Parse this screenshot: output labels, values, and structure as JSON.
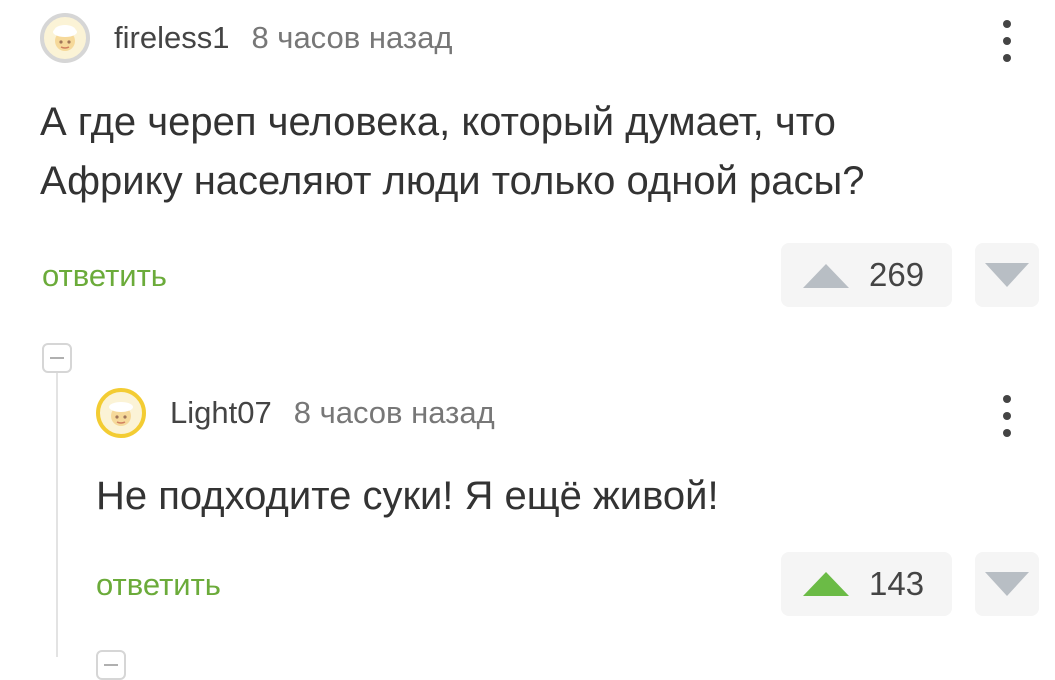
{
  "comments": [
    {
      "username": "fireless1",
      "time": "8 часов назад",
      "text_lines": [
        "А где череп человека, который думает, что",
        "Африку населяют люди только одной расы?"
      ],
      "reply_label": "ответить",
      "score": "269",
      "upvote_color": "#b8bec4"
    },
    {
      "username": "Light07",
      "time": "8 часов назад",
      "text_lines": [
        "Не подходите суки! Я ещё живой!"
      ],
      "reply_label": "ответить",
      "score": "143",
      "upvote_color": "#6bbb46"
    }
  ],
  "icons": {
    "menu": "more-vertical-icon",
    "upvote": "triangle-up-icon",
    "downvote": "triangle-down-icon",
    "collapse": "minus-icon",
    "avatar": "default-avatar-face-icon"
  }
}
